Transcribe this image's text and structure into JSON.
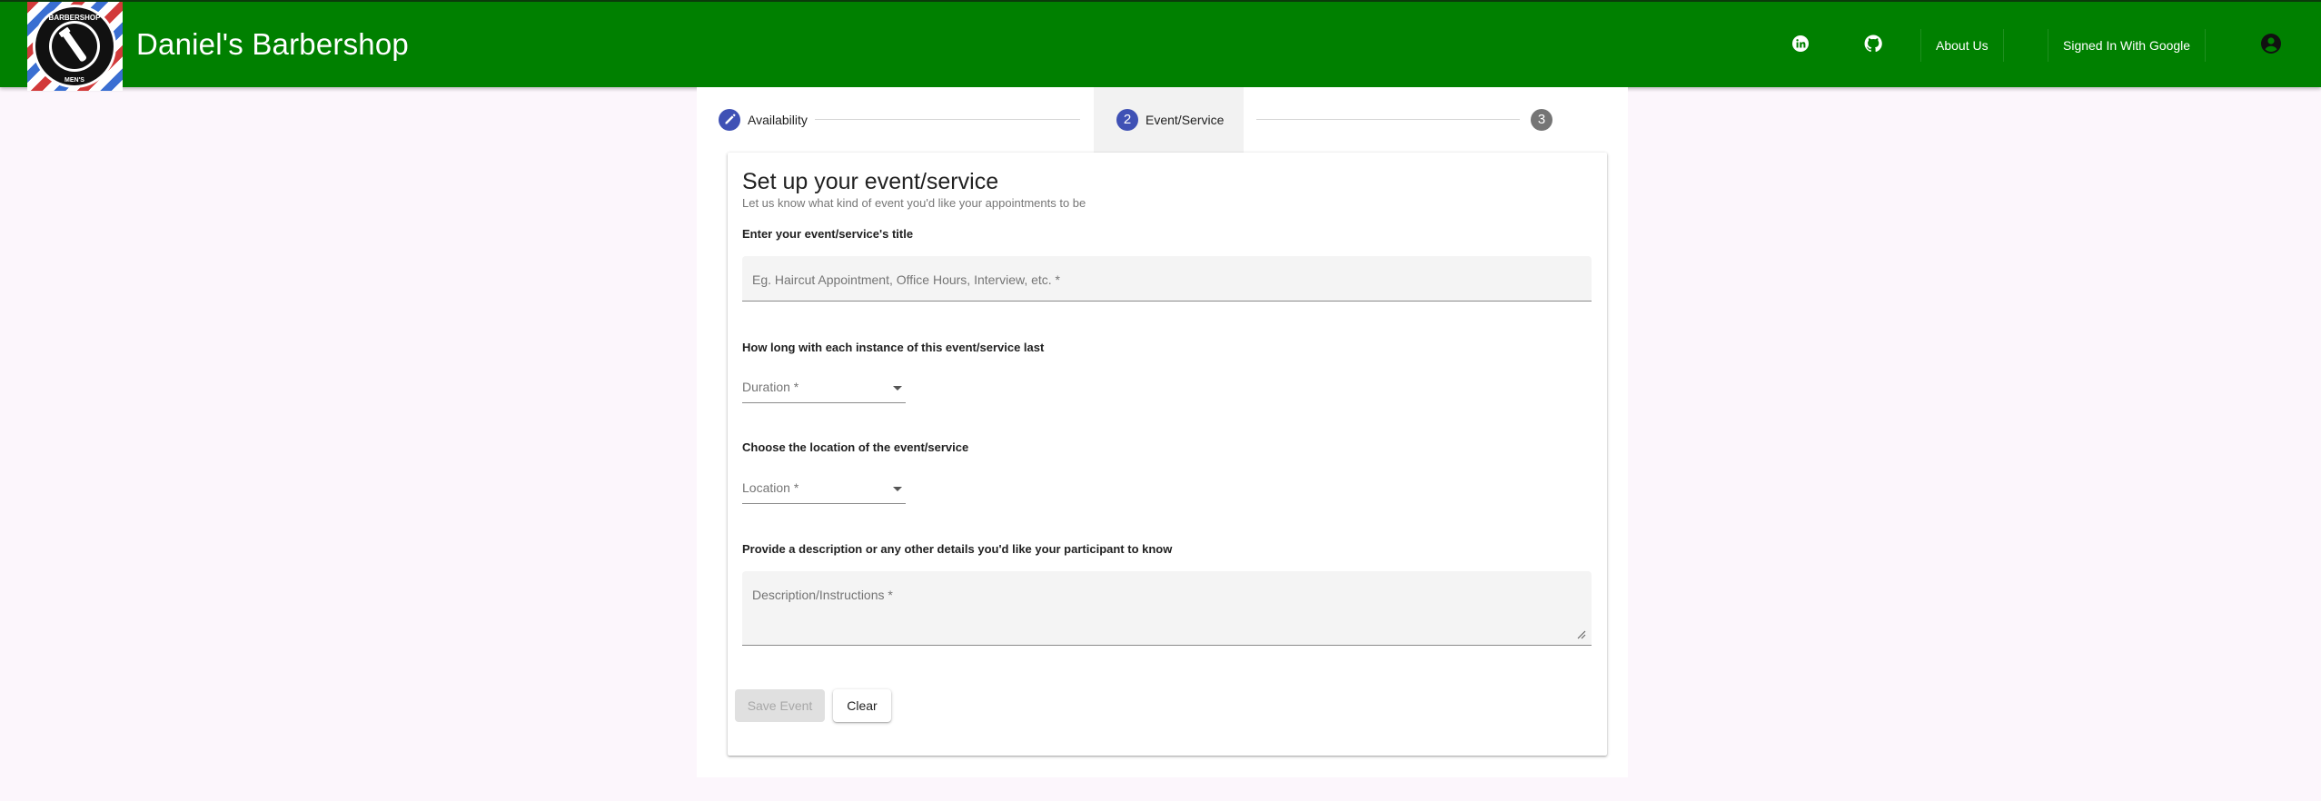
{
  "header": {
    "brand": "Daniel's Barbershop",
    "about_label": "About Us",
    "signin_label": "Signed In With Google",
    "logo_top_text": "BARBERSHOP",
    "logo_side_text": "MEN'S",
    "icons": [
      "linkedin-icon",
      "github-icon",
      "account-circle-icon"
    ]
  },
  "stepper": {
    "steps": [
      {
        "label": "Availability",
        "icon": "pencil-icon"
      },
      {
        "number": "2",
        "label": "Event/Service"
      },
      {
        "number": "3"
      }
    ]
  },
  "form": {
    "title": "Set up your event/service",
    "subtitle": "Let us know what kind of event you'd like your appointments to be",
    "q_title": "Enter your event/service's title",
    "title_placeholder": "Eg. Haircut Appointment, Office Hours, Interview, etc. *",
    "q_duration": "How long with each instance of this event/service last",
    "duration_placeholder": "Duration *",
    "q_location": "Choose the location of the event/service",
    "location_placeholder": "Location *",
    "q_description": "Provide a description or any other details you'd like your participant to know",
    "description_placeholder": "Description/Instructions *",
    "save_label": "Save Event",
    "clear_label": "Clear"
  },
  "colors": {
    "appbar": "#008000",
    "step_active": "#3f51b5",
    "step_inactive": "#757575",
    "page_bg": "#fcf6fc"
  }
}
